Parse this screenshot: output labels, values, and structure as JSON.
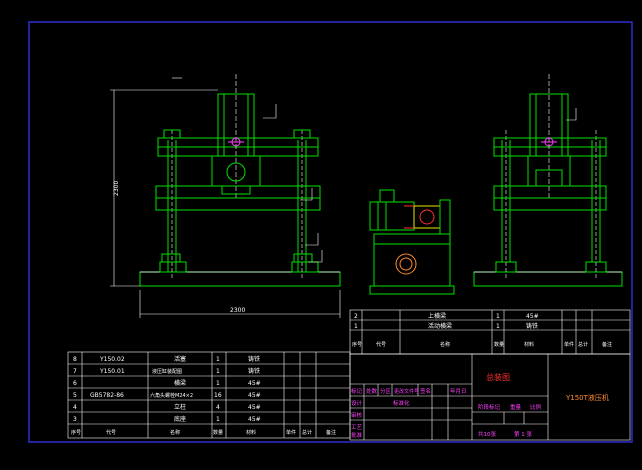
{
  "drawing": {
    "dims": {
      "height": "2300",
      "width": "2300"
    },
    "colors": {
      "background": "#000000",
      "frame": "#3a3aff",
      "green": "#00e000",
      "white": "#ffffff",
      "magenta": "#ff40ff",
      "red": "#ff3030",
      "orange": "#ff8c2a",
      "yellow": "#e8e800"
    }
  },
  "parts_list": {
    "rows": [
      {
        "no": "8",
        "code": "Y150.02",
        "name": "活塞",
        "qty": "1",
        "material": "铸铁",
        "note": ""
      },
      {
        "no": "7",
        "code": "Y150.01",
        "name": "液压缸装配图",
        "qty": "1",
        "material": "铸铁",
        "note": ""
      },
      {
        "no": "6",
        "code": "",
        "name": "横梁",
        "qty": "1",
        "material": "45#",
        "note": ""
      },
      {
        "no": "5",
        "code": "GB5782-86",
        "name": "六角头螺栓M24×2",
        "qty": "16",
        "material": "45#",
        "note": ""
      },
      {
        "no": "4",
        "code": "",
        "name": "立柱",
        "qty": "4",
        "material": "45#",
        "note": ""
      },
      {
        "no": "3",
        "code": "",
        "name": "底座",
        "qty": "1",
        "material": "45#",
        "note": ""
      }
    ],
    "header": {
      "no": "序号",
      "code": "代号",
      "name": "名称",
      "qty": "数量",
      "material": "材料",
      "single": "单件",
      "total": "总计",
      "note": "备注"
    }
  },
  "upper_parts": {
    "rows": [
      {
        "no": "2",
        "name": "上横梁",
        "qty": "1",
        "material": "45#"
      },
      {
        "no": "1",
        "name": "活动横梁",
        "qty": "1",
        "material": "铸铁"
      }
    ],
    "header": {
      "no": "序号",
      "code": "代号",
      "name": "名称",
      "qty": "数量",
      "material": "材料",
      "single": "单件",
      "total": "总计",
      "note": "备注"
    }
  },
  "title_block": {
    "drawing_title": "总装图",
    "product": "Y150T液压机",
    "row1": [
      "标记",
      "处数",
      "分区",
      "更改文件号",
      "签名",
      "年月日"
    ],
    "row2": [
      "设计",
      "标准化"
    ],
    "row3": [
      "审核"
    ],
    "row4": [
      "工艺",
      "批准"
    ],
    "stage": [
      "阶段标记",
      "重量",
      "比例"
    ],
    "sheets": [
      "共10张",
      "第 1 张"
    ]
  }
}
